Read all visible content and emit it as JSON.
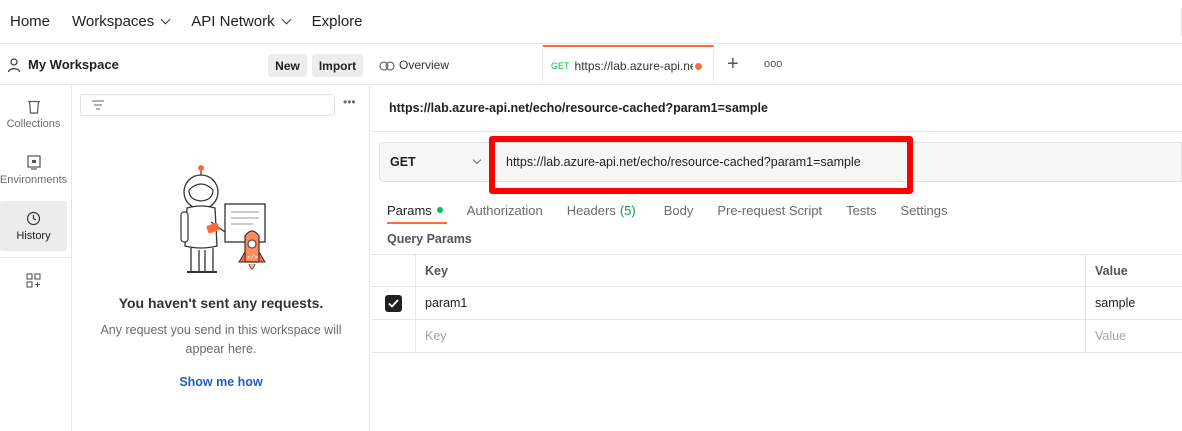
{
  "topnav": {
    "items": [
      {
        "label": "Home",
        "dropdown": false
      },
      {
        "label": "Workspaces",
        "dropdown": true
      },
      {
        "label": "API Network",
        "dropdown": true
      },
      {
        "label": "Explore",
        "dropdown": false
      }
    ]
  },
  "workspace": {
    "title": "My Workspace",
    "new_label": "New",
    "import_label": "Import"
  },
  "sidebar": {
    "items": [
      {
        "label": "Collections",
        "icon": "trash-bin-icon"
      },
      {
        "label": "Environments",
        "icon": "environment-icon"
      },
      {
        "label": "History",
        "icon": "history-icon",
        "active": true
      }
    ],
    "more_icon": "apps-add-icon"
  },
  "history_panel": {
    "empty_title": "You haven't sent any requests.",
    "empty_desc": "Any request you send in this workspace will appear here.",
    "show_me": "Show me how"
  },
  "tabs": {
    "overview_label": "Overview",
    "request_method": "GET",
    "request_url": "https://lab.azure-api.net/echo/resource-cached?param1=sample"
  },
  "request": {
    "name": "https://lab.azure-api.net/echo/resource-cached?param1=sample",
    "method": "GET",
    "url": "https://lab.azure-api.net/echo/resource-cached?param1=sample"
  },
  "subtabs": {
    "params": "Params",
    "authorization": "Authorization",
    "headers": "Headers",
    "headers_count": "(5)",
    "body": "Body",
    "prerequest": "Pre-request Script",
    "tests": "Tests",
    "settings": "Settings"
  },
  "query_params": {
    "title": "Query Params",
    "col_key": "Key",
    "col_value": "Value",
    "rows": [
      {
        "key": "param1",
        "value": "sample",
        "checked": true
      }
    ],
    "placeholder_key": "Key",
    "placeholder_value": "Value"
  },
  "colors": {
    "accent": "#ff6c37",
    "get_green": "#0cbb52",
    "highlight": "#ff0000",
    "link": "#1f5fbf"
  }
}
